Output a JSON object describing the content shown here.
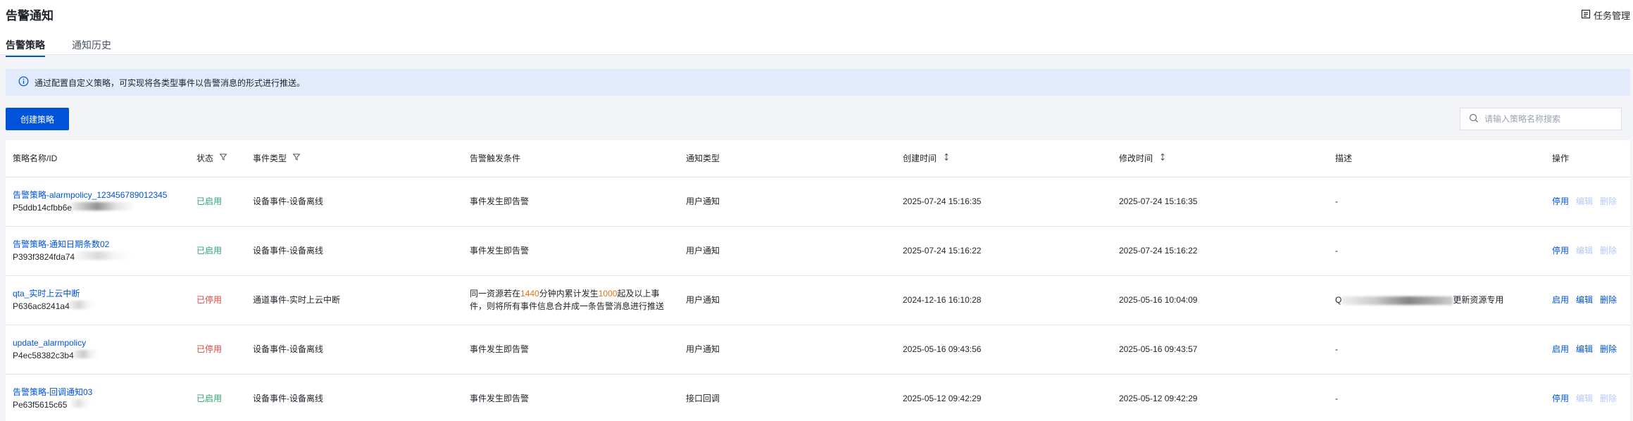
{
  "header": {
    "title": "告警通知",
    "task_mgmt": "任务管理",
    "tabs": [
      {
        "label": "告警策略"
      },
      {
        "label": "通知历史"
      }
    ]
  },
  "notice": {
    "text": "通过配置自定义策略，可实现将各类型事件以告警消息的形式进行推送。"
  },
  "toolbar": {
    "create_label": "创建策略",
    "search_placeholder": "请输入策略名称搜索"
  },
  "table": {
    "columns": [
      "策略名称/ID",
      "状态",
      "事件类型",
      "告警触发条件",
      "通知类型",
      "创建时间",
      "修改时间",
      "描述",
      "操作"
    ],
    "rows": [
      {
        "name": "告警策略-alarmpolicy_123456789012345",
        "id": "P5ddb14cfbb6e",
        "status": "已启用",
        "event_type": "设备事件-设备离线",
        "condition": "事件发生即告警",
        "notify_type": "用户通知",
        "created": "2025-07-24 15:16:35",
        "modified": "2025-07-24 15:16:35",
        "description": "-",
        "actions": [
          "停用",
          "编辑",
          "删除"
        ]
      },
      {
        "name": "告警策略-通知日期条数02",
        "id": "P393f3824fda74",
        "status": "已启用",
        "event_type": "设备事件-设备离线",
        "condition": "事件发生即告警",
        "notify_type": "用户通知",
        "created": "2025-07-24 15:16:22",
        "modified": "2025-07-24 15:16:22",
        "description": "-",
        "actions": [
          "停用",
          "编辑",
          "删除"
        ]
      },
      {
        "name": "qta_实时上云中断",
        "id": "P636ac8241a4",
        "status": "已停用",
        "event_type": "通道事件-实时上云中断",
        "condition_parts": [
          "同一资源若在",
          "1440",
          "分钟内累计发生",
          "1000",
          "起及以上事",
          "件，则将所有事件信息合并成一条告警消息进行推送"
        ],
        "notify_type": "用户通知",
        "created": "2024-12-16 16:10:28",
        "modified": "2025-05-16 10:04:09",
        "description_prefix": "Q",
        "description_suffix": "更新资源专用",
        "actions": [
          "启用",
          "编辑",
          "删除"
        ]
      },
      {
        "name": "update_alarmpolicy",
        "id": "P4ec58382c3b4",
        "status": "已停用",
        "event_type": "设备事件-设备离线",
        "condition": "事件发生即告警",
        "notify_type": "用户通知",
        "created": "2025-05-16 09:43:56",
        "modified": "2025-05-16 09:43:57",
        "description": "-",
        "actions": [
          "启用",
          "编辑",
          "删除"
        ]
      },
      {
        "name": "告警策略-回调通知03",
        "id": "Pe63f5615c65",
        "status": "已启用",
        "event_type": "设备事件-设备离线",
        "condition": "事件发生即告警",
        "notify_type": "接口回调",
        "created": "2025-05-12 09:42:29",
        "modified": "2025-05-12 09:42:29",
        "description": "-",
        "actions": [
          "停用",
          "编辑",
          "删除"
        ]
      }
    ]
  },
  "colors": {
    "primary": "#0052d9",
    "enabled": "#2ba471",
    "disabled": "#d54941",
    "highlight": "#e37318",
    "notice_bg": "#e2ebfc"
  }
}
